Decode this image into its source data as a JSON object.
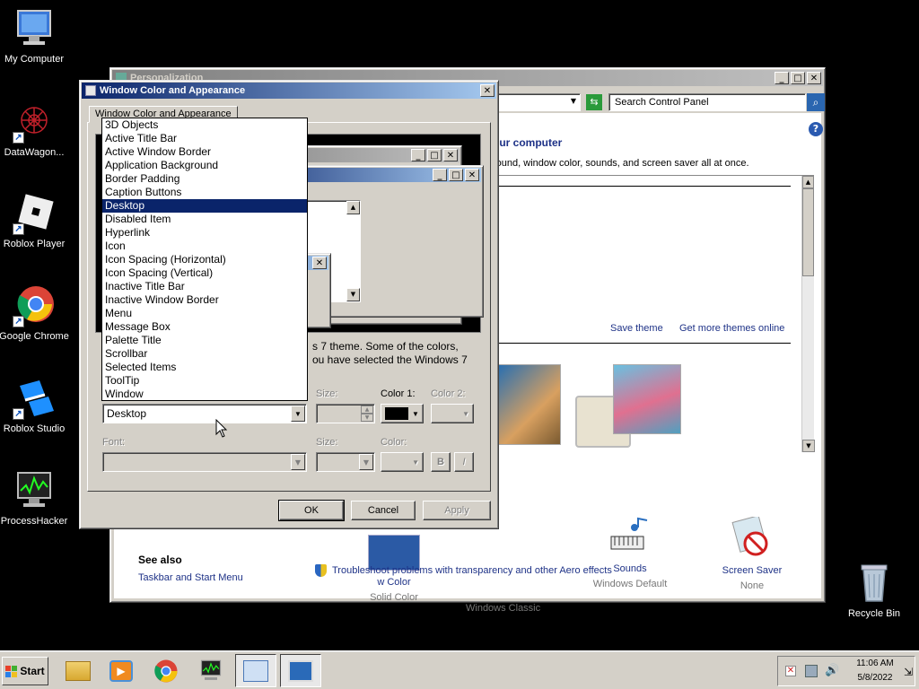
{
  "desktop": {
    "icons": [
      {
        "label": "My Computer",
        "icon": "computer-icon"
      },
      {
        "label": "DataWagon...",
        "icon": "datawagon-icon"
      },
      {
        "label": "Roblox Player",
        "icon": "roblox-icon"
      },
      {
        "label": "Google Chrome",
        "icon": "chrome-icon"
      },
      {
        "label": "Roblox Studio",
        "icon": "roblox-studio-icon"
      },
      {
        "label": "ProcessHacker",
        "icon": "processhacker-icon"
      },
      {
        "label": "Recycle Bin",
        "icon": "recycle-bin-icon"
      }
    ]
  },
  "personalization": {
    "title": "Personalization",
    "search_placeholder": "Search Control Panel",
    "heading_fragment": "our computer",
    "subtitle_fragment": "round, window color, sounds, and screen saver all at once.",
    "save_theme": "Save theme",
    "more_themes": "Get more themes online",
    "bottom_items": [
      {
        "label": "w Color",
        "sub": "Solid Color"
      },
      {
        "label": "",
        "sub": "Windows Classic"
      },
      {
        "label": "Sounds",
        "sub": "Windows Default"
      },
      {
        "label": "Screen Saver",
        "sub": "None"
      }
    ],
    "see_also_heading": "See also",
    "see_also_link": "Taskbar and Start Menu",
    "troubleshoot_link": "Troubleshoot problems with transparency and other Aero effects"
  },
  "dialog": {
    "title": "Window Color and Appearance",
    "tab": "Window Color and Appearance",
    "note_line1": "s 7 theme.  Some of the colors,",
    "note_line2": "ou have selected the Windows 7",
    "item_selected": "Desktop",
    "size_label": "Size:",
    "color1_label": "Color 1:",
    "color2_label": "Color 2:",
    "font_label": "Font:",
    "font_size_label": "Size:",
    "font_color_label": "Color:",
    "bold_label": "B",
    "italic_label": "I",
    "color1_value": "#000000",
    "ok": "OK",
    "cancel": "Cancel",
    "apply": "Apply",
    "options": [
      "3D Objects",
      "Active Title Bar",
      "Active Window Border",
      "Application Background",
      "Border Padding",
      "Caption Buttons",
      "Desktop",
      "Disabled Item",
      "Hyperlink",
      "Icon",
      "Icon Spacing (Horizontal)",
      "Icon Spacing (Vertical)",
      "Inactive Title Bar",
      "Inactive Window Border",
      "Menu",
      "Message Box",
      "Palette Title",
      "Scrollbar",
      "Selected Items",
      "ToolTip",
      "Window"
    ]
  },
  "taskbar": {
    "start_label": "Start",
    "apps": [
      "file-explorer-icon",
      "media-player-icon",
      "chrome-icon",
      "processhacker-icon",
      "control-panel-icon",
      "display-settings-icon"
    ],
    "time": "11:06 AM",
    "date": "5/8/2022"
  }
}
